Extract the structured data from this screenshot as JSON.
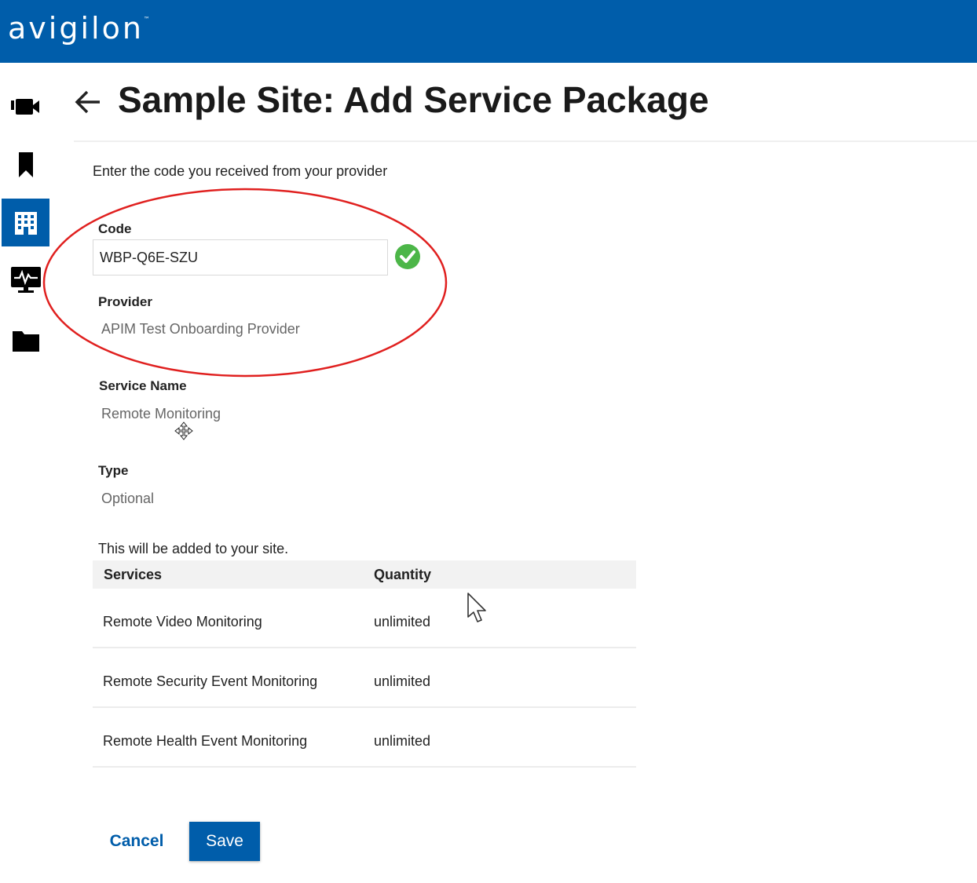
{
  "brand": {
    "logo_text": "avigilon",
    "trademark": "™",
    "color": "#005DAA"
  },
  "sidebar": {
    "items": [
      {
        "icon": "video-camera-icon",
        "active": false
      },
      {
        "icon": "bookmark-icon",
        "active": false
      },
      {
        "icon": "building-icon",
        "active": true
      },
      {
        "icon": "health-monitor-icon",
        "active": false
      },
      {
        "icon": "folder-icon",
        "active": false
      }
    ]
  },
  "header": {
    "title": "Sample Site: Add Service Package"
  },
  "form": {
    "instructions": "Enter the code you received from your provider",
    "code_label": "Code",
    "code_value": "WBP-Q6E-SZU",
    "code_valid": true,
    "provider_label": "Provider",
    "provider_value": "APIM Test Onboarding Provider",
    "service_name_label": "Service Name",
    "service_name_value": "Remote Monitoring",
    "type_label": "Type",
    "type_value": "Optional",
    "added_note": "This will be added to your site."
  },
  "services_table": {
    "headers": [
      "Services",
      "Quantity"
    ],
    "rows": [
      {
        "service": "Remote Video Monitoring",
        "quantity": "unlimited"
      },
      {
        "service": "Remote Security Event Monitoring",
        "quantity": "unlimited"
      },
      {
        "service": "Remote Health Event Monitoring",
        "quantity": "unlimited"
      }
    ]
  },
  "actions": {
    "cancel_label": "Cancel",
    "save_label": "Save"
  },
  "colors": {
    "accent": "#005DAA",
    "valid": "#4CB648",
    "highlight_annotation": "#E0201F"
  }
}
